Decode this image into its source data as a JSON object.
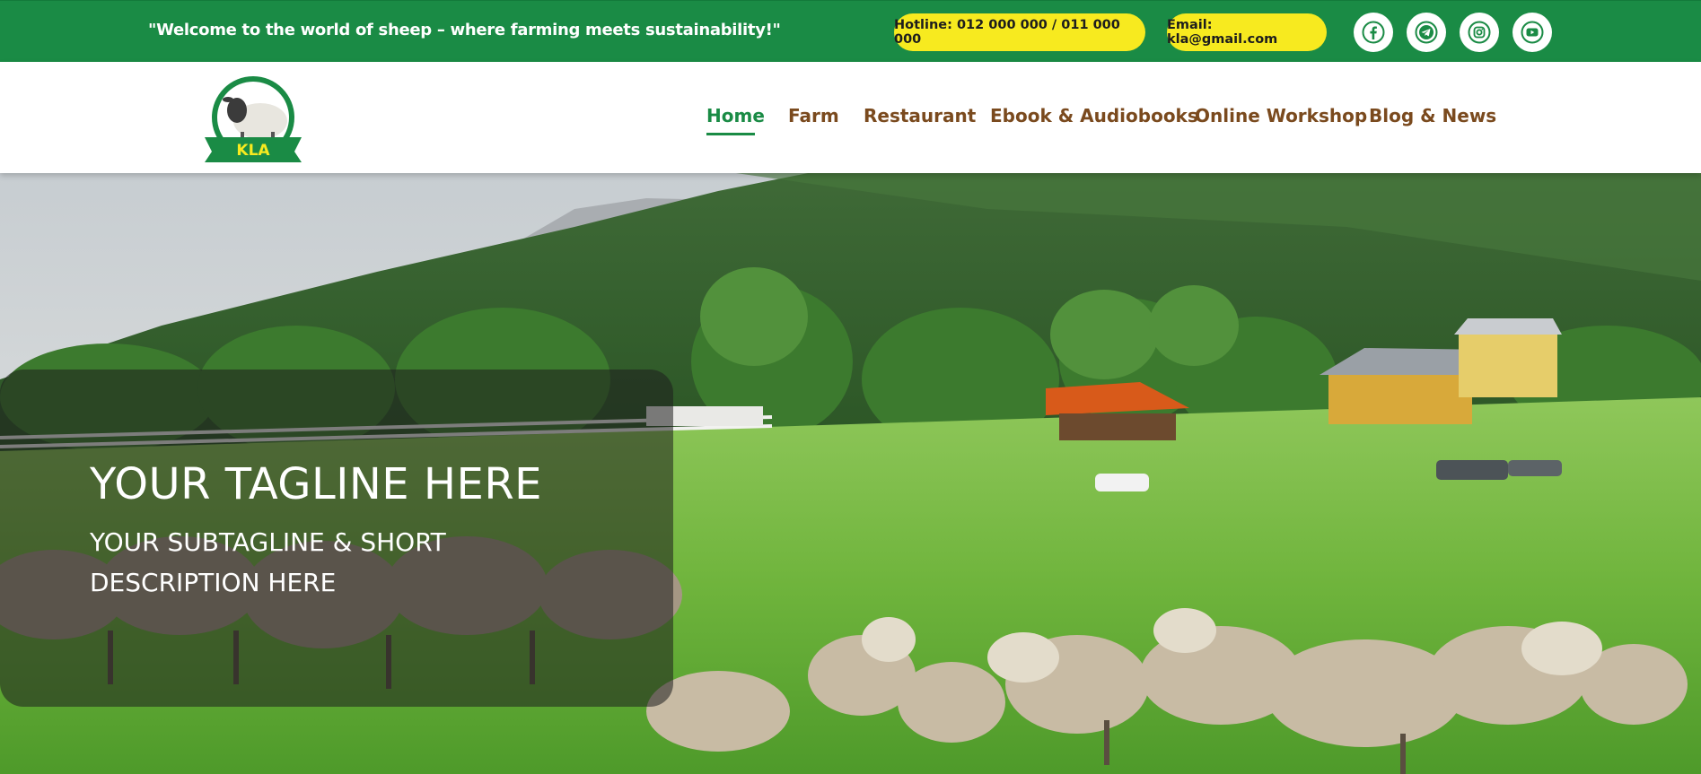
{
  "topbar": {
    "welcome_text": "\"Welcome to the world of sheep – where farming meets sustainability!\"",
    "hotline": "Hotline: 012 000 000 / 011 000 000",
    "email": "Email: kla@gmail.com",
    "social": [
      {
        "icon": "facebook-icon"
      },
      {
        "icon": "telegram-icon"
      },
      {
        "icon": "instagram-icon"
      },
      {
        "icon": "youtube-icon"
      }
    ]
  },
  "logo": {
    "text": "KLA"
  },
  "nav": {
    "items": [
      {
        "label": "Home",
        "active": true
      },
      {
        "label": "Farm"
      },
      {
        "label": "Restaurant"
      },
      {
        "label": "Ebook & Audiobooks"
      },
      {
        "label": "Online Workshop"
      },
      {
        "label": "Blog & News"
      }
    ]
  },
  "hero": {
    "tagline": "YOUR TAGLINE HERE",
    "subtagline": "YOUR SUBTAGLINE & SHORT DESCRIPTION HERE"
  },
  "colors": {
    "brand_green": "#1a8b45",
    "pill_yellow": "#f7ea1f",
    "nav_brown": "#7a4a1e"
  }
}
